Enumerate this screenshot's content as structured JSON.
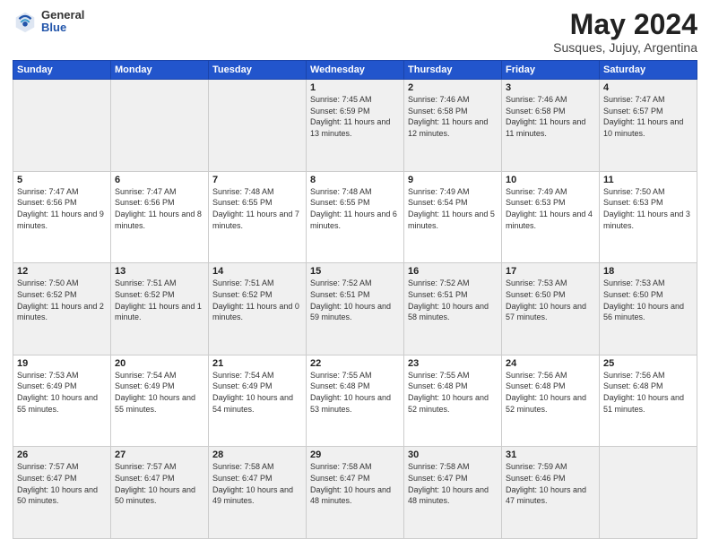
{
  "header": {
    "logo_general": "General",
    "logo_blue": "Blue",
    "title": "May 2024",
    "subtitle": "Susques, Jujuy, Argentina"
  },
  "days_of_week": [
    "Sunday",
    "Monday",
    "Tuesday",
    "Wednesday",
    "Thursday",
    "Friday",
    "Saturday"
  ],
  "weeks": [
    [
      {
        "day": "",
        "empty": true
      },
      {
        "day": "",
        "empty": true
      },
      {
        "day": "",
        "empty": true
      },
      {
        "day": "1",
        "sunrise": "7:45 AM",
        "sunset": "6:59 PM",
        "daylight": "11 hours and 13 minutes."
      },
      {
        "day": "2",
        "sunrise": "7:46 AM",
        "sunset": "6:58 PM",
        "daylight": "11 hours and 12 minutes."
      },
      {
        "day": "3",
        "sunrise": "7:46 AM",
        "sunset": "6:58 PM",
        "daylight": "11 hours and 11 minutes."
      },
      {
        "day": "4",
        "sunrise": "7:47 AM",
        "sunset": "6:57 PM",
        "daylight": "11 hours and 10 minutes."
      }
    ],
    [
      {
        "day": "5",
        "sunrise": "7:47 AM",
        "sunset": "6:56 PM",
        "daylight": "11 hours and 9 minutes."
      },
      {
        "day": "6",
        "sunrise": "7:47 AM",
        "sunset": "6:56 PM",
        "daylight": "11 hours and 8 minutes."
      },
      {
        "day": "7",
        "sunrise": "7:48 AM",
        "sunset": "6:55 PM",
        "daylight": "11 hours and 7 minutes."
      },
      {
        "day": "8",
        "sunrise": "7:48 AM",
        "sunset": "6:55 PM",
        "daylight": "11 hours and 6 minutes."
      },
      {
        "day": "9",
        "sunrise": "7:49 AM",
        "sunset": "6:54 PM",
        "daylight": "11 hours and 5 minutes."
      },
      {
        "day": "10",
        "sunrise": "7:49 AM",
        "sunset": "6:53 PM",
        "daylight": "11 hours and 4 minutes."
      },
      {
        "day": "11",
        "sunrise": "7:50 AM",
        "sunset": "6:53 PM",
        "daylight": "11 hours and 3 minutes."
      }
    ],
    [
      {
        "day": "12",
        "sunrise": "7:50 AM",
        "sunset": "6:52 PM",
        "daylight": "11 hours and 2 minutes."
      },
      {
        "day": "13",
        "sunrise": "7:51 AM",
        "sunset": "6:52 PM",
        "daylight": "11 hours and 1 minute."
      },
      {
        "day": "14",
        "sunrise": "7:51 AM",
        "sunset": "6:52 PM",
        "daylight": "11 hours and 0 minutes."
      },
      {
        "day": "15",
        "sunrise": "7:52 AM",
        "sunset": "6:51 PM",
        "daylight": "10 hours and 59 minutes."
      },
      {
        "day": "16",
        "sunrise": "7:52 AM",
        "sunset": "6:51 PM",
        "daylight": "10 hours and 58 minutes."
      },
      {
        "day": "17",
        "sunrise": "7:53 AM",
        "sunset": "6:50 PM",
        "daylight": "10 hours and 57 minutes."
      },
      {
        "day": "18",
        "sunrise": "7:53 AM",
        "sunset": "6:50 PM",
        "daylight": "10 hours and 56 minutes."
      }
    ],
    [
      {
        "day": "19",
        "sunrise": "7:53 AM",
        "sunset": "6:49 PM",
        "daylight": "10 hours and 55 minutes."
      },
      {
        "day": "20",
        "sunrise": "7:54 AM",
        "sunset": "6:49 PM",
        "daylight": "10 hours and 55 minutes."
      },
      {
        "day": "21",
        "sunrise": "7:54 AM",
        "sunset": "6:49 PM",
        "daylight": "10 hours and 54 minutes."
      },
      {
        "day": "22",
        "sunrise": "7:55 AM",
        "sunset": "6:48 PM",
        "daylight": "10 hours and 53 minutes."
      },
      {
        "day": "23",
        "sunrise": "7:55 AM",
        "sunset": "6:48 PM",
        "daylight": "10 hours and 52 minutes."
      },
      {
        "day": "24",
        "sunrise": "7:56 AM",
        "sunset": "6:48 PM",
        "daylight": "10 hours and 52 minutes."
      },
      {
        "day": "25",
        "sunrise": "7:56 AM",
        "sunset": "6:48 PM",
        "daylight": "10 hours and 51 minutes."
      }
    ],
    [
      {
        "day": "26",
        "sunrise": "7:57 AM",
        "sunset": "6:47 PM",
        "daylight": "10 hours and 50 minutes."
      },
      {
        "day": "27",
        "sunrise": "7:57 AM",
        "sunset": "6:47 PM",
        "daylight": "10 hours and 50 minutes."
      },
      {
        "day": "28",
        "sunrise": "7:58 AM",
        "sunset": "6:47 PM",
        "daylight": "10 hours and 49 minutes."
      },
      {
        "day": "29",
        "sunrise": "7:58 AM",
        "sunset": "6:47 PM",
        "daylight": "10 hours and 48 minutes."
      },
      {
        "day": "30",
        "sunrise": "7:58 AM",
        "sunset": "6:47 PM",
        "daylight": "10 hours and 48 minutes."
      },
      {
        "day": "31",
        "sunrise": "7:59 AM",
        "sunset": "6:46 PM",
        "daylight": "10 hours and 47 minutes."
      },
      {
        "day": "",
        "empty": true
      }
    ]
  ]
}
